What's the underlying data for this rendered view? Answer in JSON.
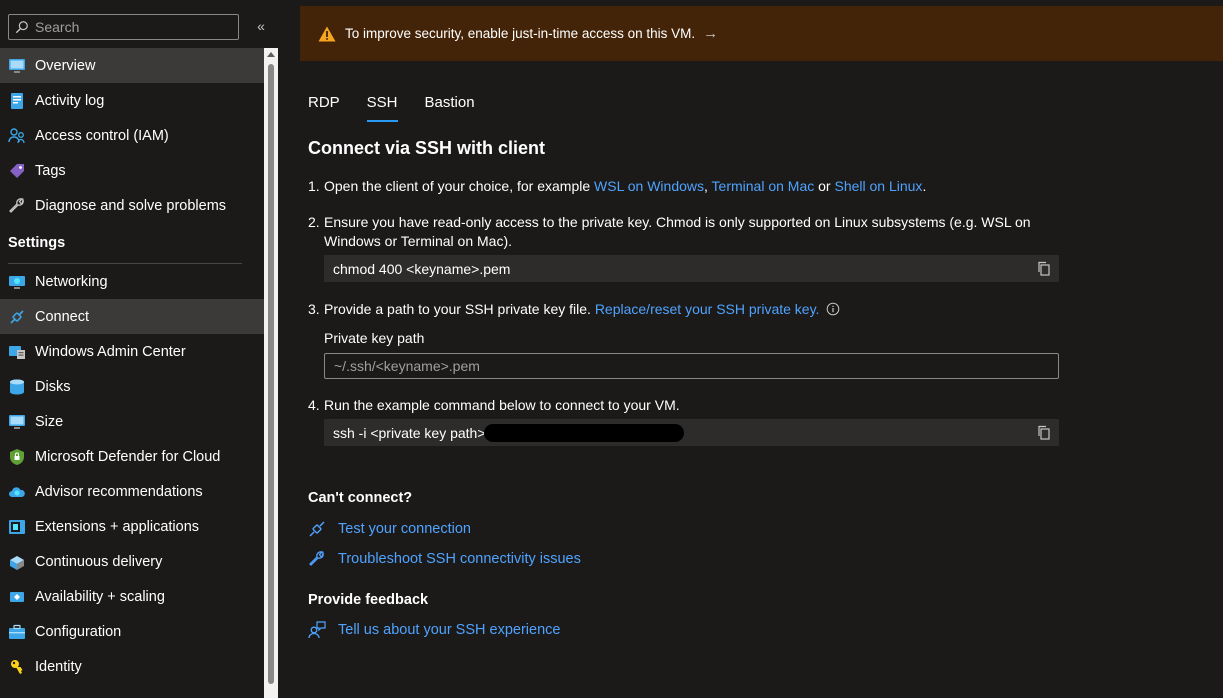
{
  "sidebar": {
    "search_placeholder": "Search",
    "collapse_icon": "«",
    "items": [
      {
        "label": "Overview",
        "icon": "monitor-icon",
        "active": true
      },
      {
        "label": "Activity log",
        "icon": "activity-log-icon"
      },
      {
        "label": "Access control (IAM)",
        "icon": "people-icon"
      },
      {
        "label": "Tags",
        "icon": "tag-icon"
      },
      {
        "label": "Diagnose and solve problems",
        "icon": "wrench-icon"
      }
    ],
    "settings_heading": "Settings",
    "settings_items": [
      {
        "label": "Networking",
        "icon": "networking-icon"
      },
      {
        "label": "Connect",
        "icon": "plug-icon",
        "active": true
      },
      {
        "label": "Windows Admin Center",
        "icon": "admin-center-icon"
      },
      {
        "label": "Disks",
        "icon": "disk-icon"
      },
      {
        "label": "Size",
        "icon": "monitor-icon"
      },
      {
        "label": "Microsoft Defender for Cloud",
        "icon": "shield-icon"
      },
      {
        "label": "Advisor recommendations",
        "icon": "advisor-cloud-icon"
      },
      {
        "label": "Extensions + applications",
        "icon": "extensions-icon"
      },
      {
        "label": "Continuous delivery",
        "icon": "delivery-icon"
      },
      {
        "label": "Availability + scaling",
        "icon": "scaling-icon"
      },
      {
        "label": "Configuration",
        "icon": "toolbox-icon"
      },
      {
        "label": "Identity",
        "icon": "key-icon"
      }
    ]
  },
  "banner": {
    "text": "To improve security, enable just-in-time access on this VM.",
    "arrow": "→"
  },
  "tabs": [
    {
      "label": "RDP"
    },
    {
      "label": "SSH",
      "active": true
    },
    {
      "label": "Bastion"
    }
  ],
  "content": {
    "title": "Connect via SSH with client",
    "step1": {
      "num": "1.",
      "text": "Open the client of your choice, for example ",
      "link1": "WSL on Windows",
      "sep1": ", ",
      "link2": "Terminal on Mac",
      "sep2": " or ",
      "link3": "Shell on Linux",
      "end": "."
    },
    "step2": {
      "num": "2.",
      "line1": "Ensure you have read-only access to the private key. Chmod is only supported on Linux subsystems (e.g. WSL on",
      "line2": "Windows or Terminal on Mac).",
      "code": "chmod 400 <keyname>.pem"
    },
    "step3": {
      "num": "3.",
      "text": "Provide a path to your SSH private key file. ",
      "link": "Replace/reset your SSH private key.",
      "field_label": "Private key path",
      "field_placeholder": "~/.ssh/<keyname>.pem"
    },
    "step4": {
      "num": "4.",
      "text": "Run the example command below to connect to your VM.",
      "code": "ssh -i <private key path> "
    },
    "cant_connect": {
      "title": "Can't connect?",
      "links": [
        "Test your connection",
        "Troubleshoot SSH connectivity issues"
      ]
    },
    "feedback": {
      "title": "Provide feedback",
      "link": "Tell us about your SSH experience"
    }
  },
  "colors": {
    "accent": "#2899f5",
    "link": "#4fa3ff",
    "banner_bg": "#442408",
    "warning": "#f7a51c"
  }
}
